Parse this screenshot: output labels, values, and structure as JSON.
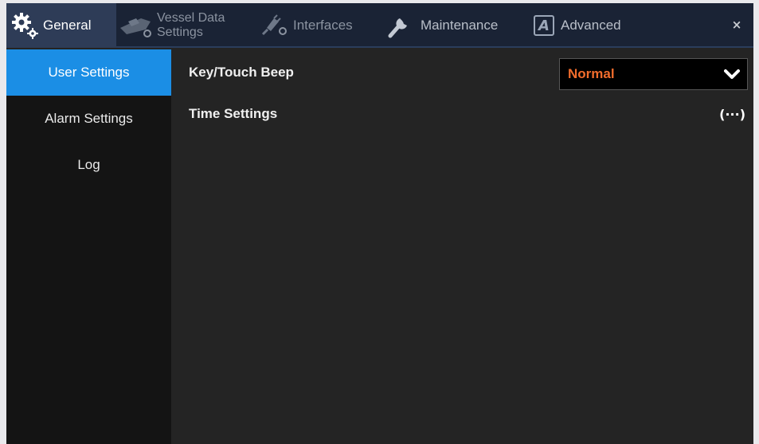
{
  "tabs": {
    "general": "General",
    "vessel_line1": "Vessel Data",
    "vessel_line2": "Settings",
    "interfaces": "Interfaces",
    "maintenance": "Maintenance",
    "advanced": "Advanced",
    "advanced_icon_letter": "A",
    "active": "General"
  },
  "close_label": "×",
  "sidebar": {
    "items": [
      {
        "label": "User Settings",
        "active": true
      },
      {
        "label": "Alarm Settings",
        "active": false
      },
      {
        "label": "Log",
        "active": false
      }
    ]
  },
  "settings": {
    "key_touch_beep": {
      "label": "Key/Touch Beep",
      "value": "Normal"
    },
    "time_settings": {
      "label": "Time Settings",
      "button": "(···)"
    }
  },
  "colors": {
    "accent": "#1b8ee5",
    "value_orange": "#f06c2c",
    "tabbar": "#1a2335",
    "active_tab": "#2e3c57",
    "background": "#242424"
  },
  "icons": {
    "general": "gear-icon",
    "vessel": "vessel-icon",
    "interfaces": "plug-icon",
    "maintenance": "wrench-icon",
    "advanced": "advanced-a-icon",
    "close": "close-icon",
    "dropdown": "chevron-down-icon"
  }
}
